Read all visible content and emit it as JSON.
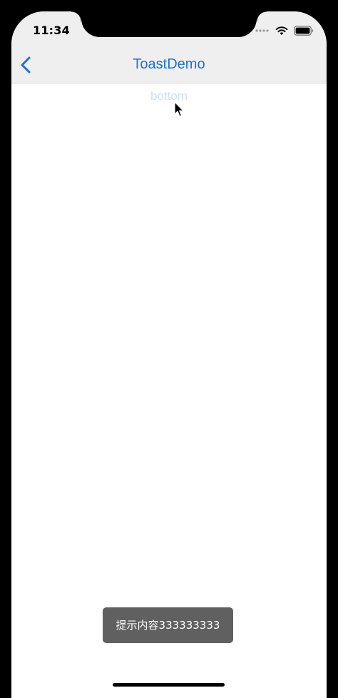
{
  "status_bar": {
    "time": "11:34",
    "icons": [
      "signal-icon",
      "wifi-icon",
      "battery-icon"
    ]
  },
  "navbar": {
    "title": "ToastDemo",
    "back_icon": "chevron-left-icon",
    "accent_color": "#1d70d8"
  },
  "content": {
    "button_label": "bottom"
  },
  "toast": {
    "message": "提示内容333333333"
  },
  "colors": {
    "nav_background": "#efefef",
    "toast_background": "#606060",
    "button_text": "#c9e0f6"
  }
}
